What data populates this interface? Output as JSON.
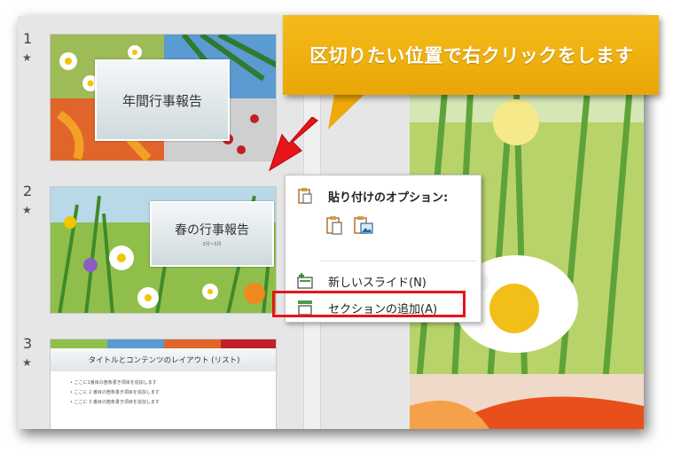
{
  "callout": {
    "text": "区切りたい位置で右クリックをします"
  },
  "slides": [
    {
      "number": "1",
      "star": "★",
      "title": "年間行事報告"
    },
    {
      "number": "2",
      "star": "★",
      "title": "春の行事報告",
      "subtitle": "3月〜5月"
    },
    {
      "number": "3",
      "star": "★",
      "title": "タイトルとコンテンツのレイアウト (リスト)",
      "bullets": [
        "ここに1番目の箇条書き項目を追加します",
        "ここに 2 番目の箇条書き項目を追加します",
        "ここに 3 番目の箇条書き項目を追加します"
      ]
    }
  ],
  "context_menu": {
    "paste_header": "貼り付けのオプション:",
    "new_slide": "新しいスライド(N)",
    "add_section": "セクションの追加(A)"
  },
  "colors": {
    "callout": "#f0b414",
    "highlight": "#e8141b",
    "arrow": "#e8141b"
  }
}
